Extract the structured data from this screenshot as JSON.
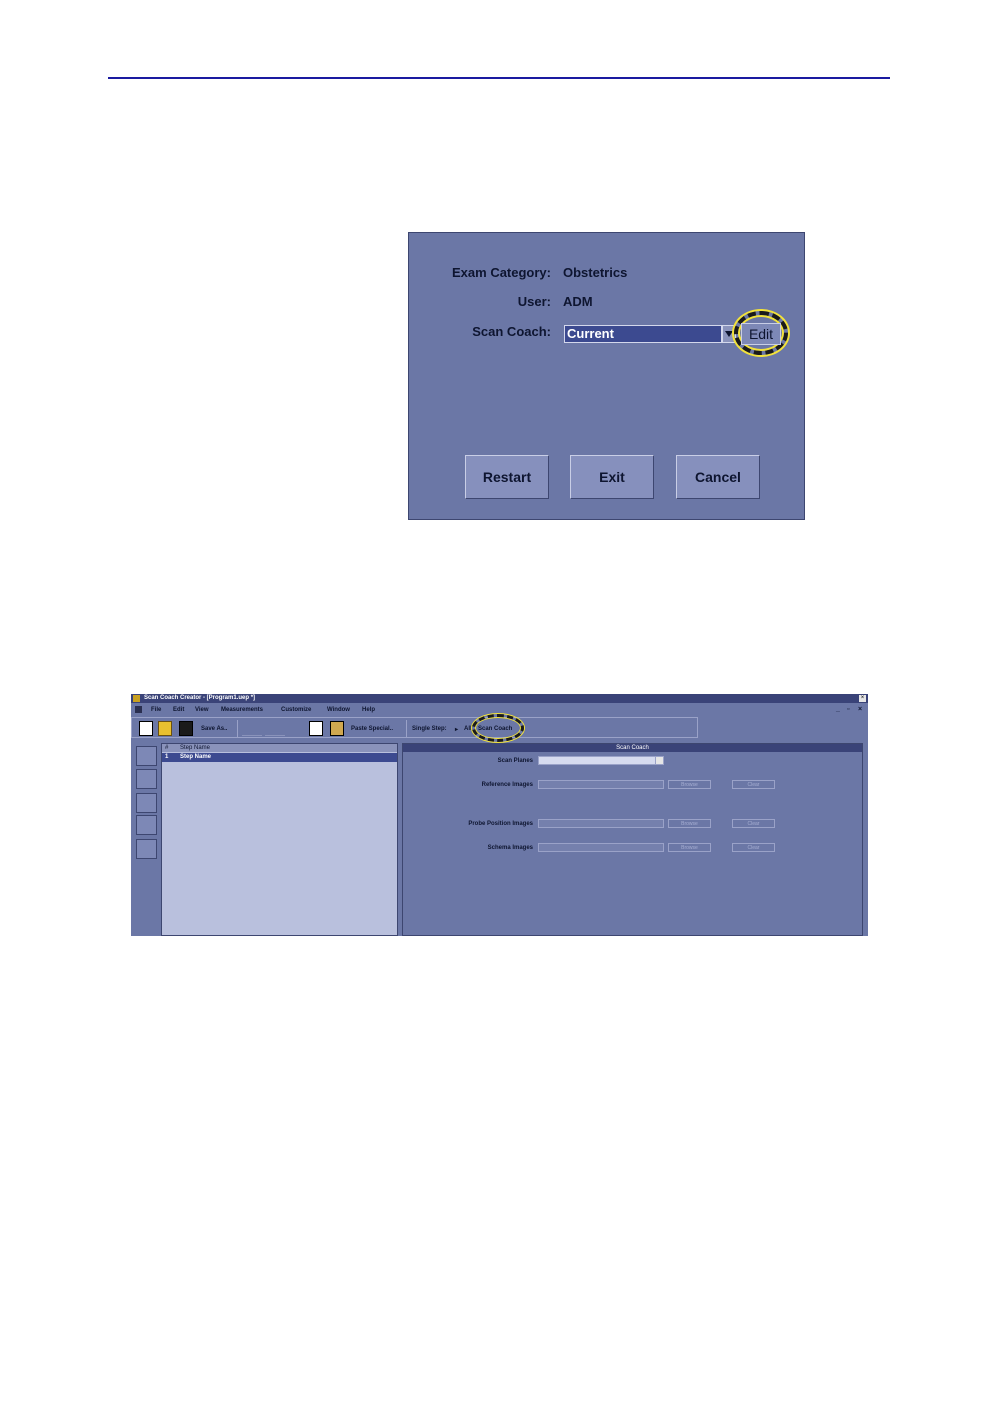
{
  "dialog": {
    "exam_category_label": "Exam Category:",
    "exam_category_value": "Obstetrics",
    "user_label": "User:",
    "user_value": "ADM",
    "scan_coach_label": "Scan Coach:",
    "scan_coach_value": "Current",
    "edit_label": "Edit",
    "buttons": {
      "restart": "Restart",
      "exit": "Exit",
      "cancel": "Cancel"
    }
  },
  "window": {
    "title": "Scan Coach Creator - [Program1.uep *]",
    "menu": [
      "File",
      "Edit",
      "View",
      "Measurements",
      "Customize",
      "Window",
      "Help"
    ],
    "toolbar": {
      "save_as": "Save As..",
      "paste_special": "Paste Special..",
      "single_step": "Single Step:",
      "all": "All",
      "scan_coach": "Scan Coach"
    },
    "list": {
      "col_num": "#",
      "col_name": "Step Name",
      "row_num": "1",
      "row_name": "Step Name"
    },
    "panel": {
      "title": "Scan Coach",
      "scan_planes": "Scan Planes",
      "reference_images": "Reference Images",
      "probe_position_images": "Probe Position Images",
      "schema_images": "Schema Images",
      "browse": "Browse",
      "clear": "Clear"
    }
  },
  "colors": {
    "accent_line": "#1a1aa0",
    "dialog_bg": "#6b77a6",
    "highlight": "#f2e23a"
  }
}
